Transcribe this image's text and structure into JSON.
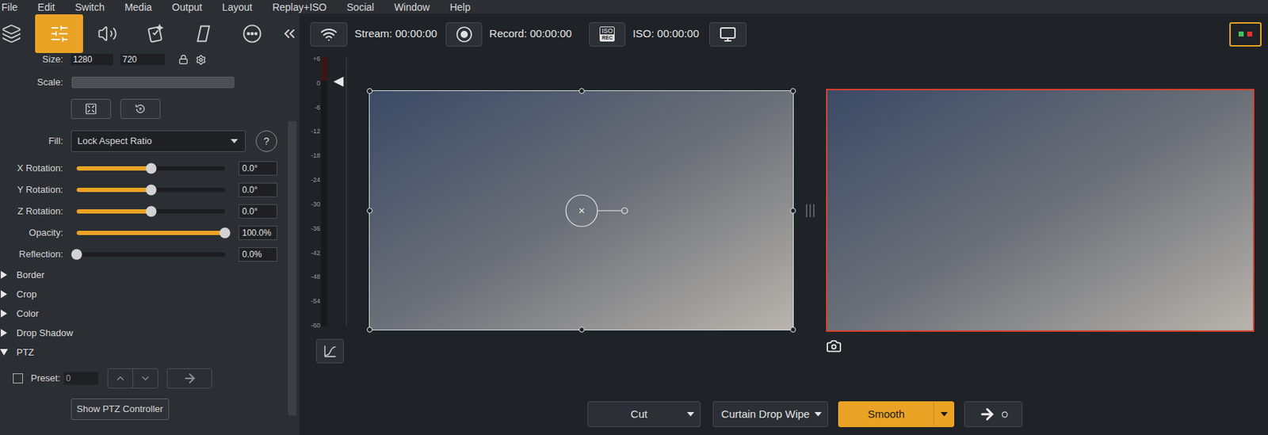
{
  "menu": [
    "File",
    "Edit",
    "Switch",
    "Media",
    "Output",
    "Layout",
    "Replay+ISO",
    "Social",
    "Window",
    "Help"
  ],
  "panel_tabs": [
    {
      "selected": false
    },
    {
      "selected": true
    },
    {
      "selected": false
    },
    {
      "selected": false
    },
    {
      "selected": false
    },
    {
      "selected": false
    }
  ],
  "size": {
    "label": "Size:",
    "width": "1280",
    "height": "720"
  },
  "scale": {
    "label": "Scale:",
    "disabled": true
  },
  "fill": {
    "label": "Fill:",
    "value": "Lock Aspect Ratio",
    "help": "?"
  },
  "sliders": [
    {
      "label": "X Rotation:",
      "level": 0.5,
      "value": "0.0°"
    },
    {
      "label": "Y Rotation:",
      "level": 0.5,
      "value": "0.0°"
    },
    {
      "label": "Z Rotation:",
      "level": 0.5,
      "value": "0.0°"
    },
    {
      "label": "Opacity:",
      "level": 1,
      "value": "100.0%"
    },
    {
      "label": "Reflection:",
      "level": 0,
      "value": "0.0%"
    }
  ],
  "sections": [
    {
      "label": "Border",
      "expanded": false
    },
    {
      "label": "Crop",
      "expanded": false
    },
    {
      "label": "Color",
      "expanded": false
    },
    {
      "label": "Drop Shadow",
      "expanded": false
    },
    {
      "label": "PTZ",
      "expanded": true
    }
  ],
  "ptz": {
    "preset_label": "Preset:",
    "preset_checked": false,
    "preset_value": "0",
    "button": "Show PTZ Controller"
  },
  "toolbar": {
    "stream": "Stream: 00:00:00",
    "record": "Record: 00:00:00",
    "iso_icon": [
      "ISO",
      "REC"
    ],
    "iso": "ISO: 00:00:00"
  },
  "status_lights": [
    {
      "color": "#3ec35a"
    },
    {
      "color": "#e0342f"
    }
  ],
  "meter": {
    "ticks": [
      "+6",
      "0",
      "-6",
      "-12",
      "-18",
      "-24",
      "-30",
      "-36",
      "-42",
      "-48",
      "-54",
      "-60"
    ],
    "level": 0,
    "volume_level": 0.907
  },
  "transitions": [
    {
      "label": "Cut",
      "kind": "dropdown",
      "selected": false
    },
    {
      "label": "Curtain Drop Wipe",
      "kind": "dropdown",
      "selected": false
    },
    {
      "label": "Smooth",
      "kind": "split",
      "selected": true
    }
  ]
}
